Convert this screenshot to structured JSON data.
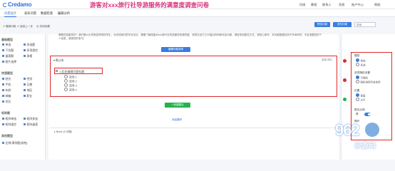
{
  "app": {
    "logo": "Credamo",
    "survey_title": "游客对xxx旅行社导游服务的满意度调查问卷",
    "topnav": [
      "问阅",
      "教程",
      "联系人",
      "消息",
      "账户中心",
      "帮助"
    ]
  },
  "tabs": [
    "问卷设计",
    "发布问卷",
    "数据检查",
    "编辑分析"
  ],
  "toolbar": {
    "left": [
      "↺ 撤销问卷",
      "✕ 返回上一步",
      "▣ 关闭标题"
    ],
    "right_buttons": [
      "预览问卷",
      "发布问卷"
    ],
    "search_placeholder": "搜索"
  },
  "sidebar": {
    "sections": [
      {
        "title": "基础题型",
        "items": [
          "单选",
          "多选题",
          "下拉题",
          "多项填空",
          "量表题",
          "表格",
          "图片选择"
        ]
      },
      {
        "title": "快速题型",
        "items": [
          "姓名",
          "性别",
          "手机",
          "日期",
          "年龄",
          "地区",
          "邮箱",
          "职业",
          "学历"
        ]
      },
      {
        "title": "矩阵题",
        "items": [
          "矩阵单选",
          "矩阵多选",
          "矩阵填空",
          "矩阵量表"
        ]
      },
      {
        "title": "其他题型",
        "items": [
          "比例/滑块题(其他)"
        ]
      }
    ]
  },
  "main": {
    "intro": "尊敬的游客您好！我们是xx大学旅游学院的学生，为完成我们的毕业设计，需要了解游客对xxx旅行社导游服务的满意度，请您在百忙之中抽出时间填写此问卷，调查采用匿名方式，请放心填写。本问卷数据仅用于学术研究，不会泄露您的个人信息，感谢您的参与！",
    "add_intro_button": "编辑问卷说明",
    "question_block": {
      "header": "▾ 默认块",
      "header_right": "编辑 删除",
      "title": "1.此处编辑问题标题",
      "options": [
        "选项 1",
        "选项 2",
        "选项 3",
        "选项 4"
      ]
    },
    "add_question_button": "+ 新建题目",
    "bottom_link": "添加题块",
    "second_block": "▸ Block (0 问题)"
  },
  "right_panel": {
    "groups": [
      {
        "label": "题型",
        "options": [
          "单选",
          "多选"
        ]
      },
      {
        "label": "选项随机设置",
        "options": [
          "不随机",
          "随机排序所有选项"
        ]
      },
      {
        "label": "位置",
        "options": [
          "竖直",
          "水平"
        ]
      },
      {
        "label": "是否必填",
        "options": [
          "是"
        ]
      },
      {
        "label": "操作",
        "options": []
      }
    ]
  },
  "watermark": {
    "text": "962",
    "sub": "乐游网"
  },
  "colors": {
    "accent": "#3b7ddd",
    "title": "#d8327d",
    "highlight": "#e0282b",
    "green": "#24b34b"
  }
}
